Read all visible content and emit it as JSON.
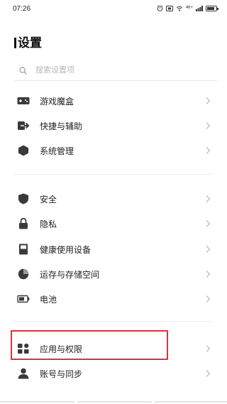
{
  "status_bar": {
    "time": "07:26",
    "network_label": "46+",
    "battery_level": 0.8
  },
  "page": {
    "title": "设置"
  },
  "search": {
    "placeholder": "搜索设置项"
  },
  "groups": [
    {
      "items": [
        {
          "label": "游戏魔盒",
          "icon": "gamepad-icon"
        },
        {
          "label": "快捷与辅助",
          "icon": "shortcut-arrow-icon"
        },
        {
          "label": "系统管理",
          "icon": "hexagon-system-icon"
        }
      ]
    },
    {
      "items": [
        {
          "label": "安全",
          "icon": "shield-icon"
        },
        {
          "label": "隐私",
          "icon": "lock-icon"
        },
        {
          "label": "健康使用设备",
          "icon": "hourglass-icon"
        },
        {
          "label": "运存与存储空间",
          "icon": "storage-pie-icon"
        },
        {
          "label": "电池",
          "icon": "battery-icon"
        }
      ]
    },
    {
      "items": [
        {
          "label": "应用与权限",
          "icon": "apps-grid-icon",
          "highlighted": true
        },
        {
          "label": "账号与同步",
          "icon": "user-account-icon"
        }
      ]
    }
  ],
  "colors": {
    "highlight": "#d7343f",
    "icon": "#3a3a3a",
    "chevron": "#b5b5b5"
  }
}
